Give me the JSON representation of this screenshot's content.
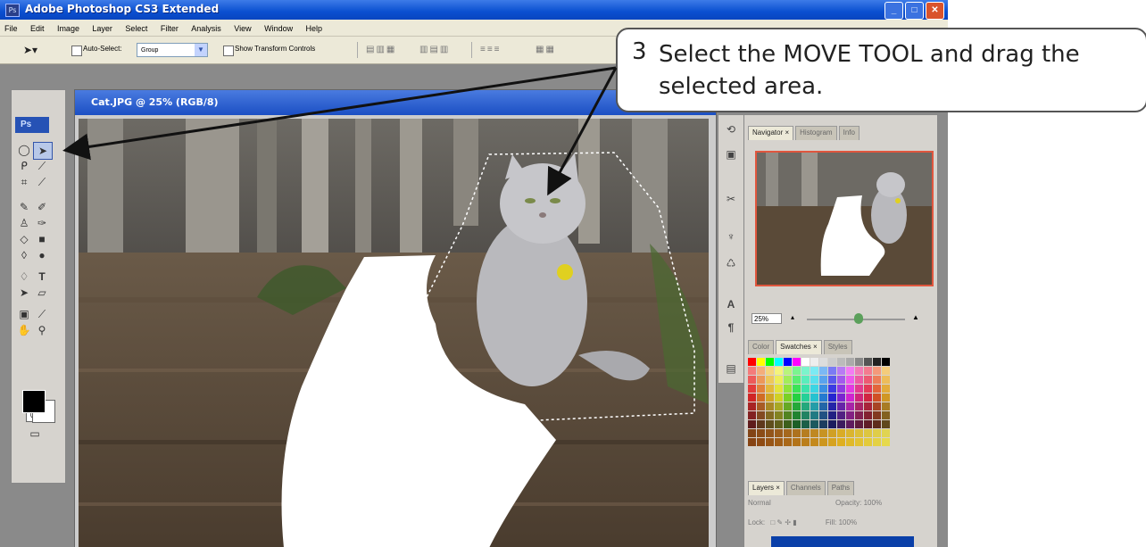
{
  "window": {
    "title": "Adobe Photoshop CS3 Extended",
    "app_icon_label": "Ps"
  },
  "menu": [
    "File",
    "Edit",
    "Image",
    "Layer",
    "Select",
    "Filter",
    "Analysis",
    "View",
    "Window",
    "Help"
  ],
  "options_bar": {
    "auto_select_label": "Auto-Select:",
    "auto_select_value": "Group",
    "show_transform_label": "Show Transform Controls"
  },
  "toolbox": {
    "logo": "Ps",
    "tools": [
      "marquee",
      "move",
      "lasso",
      "magic-wand",
      "crop",
      "slice",
      "healing",
      "brush",
      "clone-stamp",
      "history-brush",
      "eraser",
      "gradient",
      "blur",
      "dodge",
      "pen",
      "type",
      "path-select",
      "shape",
      "notes",
      "eyedropper",
      "hand",
      "zoom"
    ],
    "foreground_color": "#000000",
    "background_color": "#ffffff"
  },
  "document": {
    "title": "Cat.JPG @ 25% (RGB/8)"
  },
  "panels": {
    "navigator_tabs": [
      "Navigator ×",
      "Histogram",
      "Info"
    ],
    "zoom_value": "25%",
    "swatch_tabs": [
      "Color",
      "Swatches ×",
      "Styles"
    ],
    "layer_tabs": [
      "Layers ×",
      "Channels",
      "Paths"
    ],
    "blend_mode": "Normal",
    "opacity_label": "Opacity:",
    "opacity_value": "100%",
    "lock_label": "Lock:",
    "fill_label": "Fill:",
    "fill_value": "100%"
  },
  "callout": {
    "step": "3",
    "text": "Select the MOVE TOOL and drag the selected area."
  },
  "colors": {
    "xp_blue": "#0a4fd0",
    "panel_bg": "#d6d3ce",
    "nav_border": "#e0563e"
  }
}
